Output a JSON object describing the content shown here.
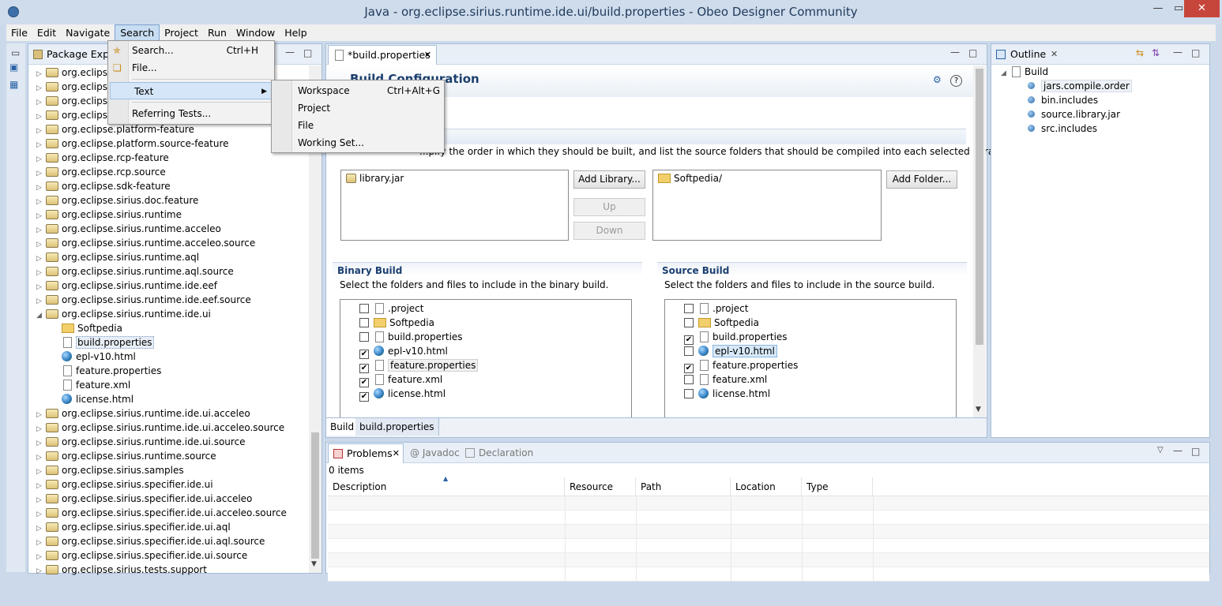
{
  "window": {
    "title": "Java - org.eclipse.sirius.runtime.ide.ui/build.properties - Obeo Designer Community"
  },
  "menubar": [
    "File",
    "Edit",
    "Navigate",
    "Search",
    "Project",
    "Run",
    "Window",
    "Help"
  ],
  "search_menu": {
    "items": [
      {
        "label": "Search...",
        "shortcut": "Ctrl+H"
      },
      {
        "label": "File...",
        "shortcut": ""
      },
      {
        "label": "Text",
        "shortcut": ""
      },
      {
        "label": "Referring Tests...",
        "shortcut": ""
      }
    ],
    "submenu": [
      {
        "label": "Workspace",
        "shortcut": "Ctrl+Alt+G"
      },
      {
        "label": "Project",
        "shortcut": ""
      },
      {
        "label": "File",
        "shortcut": ""
      },
      {
        "label": "Working Set...",
        "shortcut": ""
      }
    ]
  },
  "package_explorer": {
    "tab": "Package Explor",
    "items_partial": [
      "org.eclipse",
      "org.eclipse",
      "org.eclipse",
      "org.eclipse"
    ],
    "items": [
      "org.eclipse.platform-feature",
      "org.eclipse.platform.source-feature",
      "org.eclipse.rcp-feature",
      "org.eclipse.rcp.source",
      "org.eclipse.sdk-feature",
      "org.eclipse.sirius.doc.feature",
      "org.eclipse.sirius.runtime",
      "org.eclipse.sirius.runtime.acceleo",
      "org.eclipse.sirius.runtime.acceleo.source",
      "org.eclipse.sirius.runtime.aql",
      "org.eclipse.sirius.runtime.aql.source",
      "org.eclipse.sirius.runtime.ide.eef",
      "org.eclipse.sirius.runtime.ide.eef.source",
      "org.eclipse.sirius.runtime.ide.ui"
    ],
    "children": [
      "Softpedia",
      "build.properties",
      "epl-v10.html",
      "feature.properties",
      "feature.xml",
      "license.html"
    ],
    "items_after": [
      "org.eclipse.sirius.runtime.ide.ui.acceleo",
      "org.eclipse.sirius.runtime.ide.ui.acceleo.source",
      "org.eclipse.sirius.runtime.ide.ui.source",
      "org.eclipse.sirius.runtime.source",
      "org.eclipse.sirius.samples",
      "org.eclipse.sirius.specifier.ide.ui",
      "org.eclipse.sirius.specifier.ide.ui.acceleo",
      "org.eclipse.sirius.specifier.ide.ui.acceleo.source",
      "org.eclipse.sirius.specifier.ide.ui.aql",
      "org.eclipse.sirius.specifier.ide.ui.aql.source",
      "org.eclipse.sirius.specifier.ide.ui.source",
      "org.eclipse.sirius.tests.support"
    ]
  },
  "editor": {
    "tab": "*build.properties",
    "heading": "Build Configuration",
    "description": "...pify the order in which they should be built, and list the source folders that should be compiled into each selected library.",
    "library": "library.jar",
    "folder": "Softpedia/",
    "buttons": {
      "add_library": "Add Library...",
      "up": "Up",
      "down": "Down",
      "add_folder": "Add Folder..."
    },
    "binary": {
      "title": "Binary Build",
      "desc": "Select the folders and files to include in the binary build.",
      "items": [
        {
          "name": ".project",
          "checked": false
        },
        {
          "name": "Softpedia",
          "checked": false
        },
        {
          "name": "build.properties",
          "checked": false
        },
        {
          "name": "epl-v10.html",
          "checked": true
        },
        {
          "name": "feature.properties",
          "checked": true
        },
        {
          "name": "feature.xml",
          "checked": true
        },
        {
          "name": "license.html",
          "checked": true
        }
      ]
    },
    "source": {
      "title": "Source Build",
      "desc": "Select the folders and files to include in the source build.",
      "items": [
        {
          "name": ".project",
          "checked": false
        },
        {
          "name": "Softpedia",
          "checked": false
        },
        {
          "name": "build.properties",
          "checked": true
        },
        {
          "name": "epl-v10.html",
          "checked": false
        },
        {
          "name": "feature.properties",
          "checked": true
        },
        {
          "name": "feature.xml",
          "checked": false
        },
        {
          "name": "license.html",
          "checked": false
        }
      ]
    },
    "bottom_tabs": [
      "Build",
      "build.properties"
    ]
  },
  "outline": {
    "tab": "Outline",
    "root": "Build",
    "items": [
      "jars.compile.order",
      "bin.includes",
      "source.library.jar",
      "src.includes"
    ]
  },
  "problems": {
    "tabs": [
      "Problems",
      "Javadoc",
      "Declaration"
    ],
    "count": "0 items",
    "columns": [
      "Description",
      "Resource",
      "Path",
      "Location",
      "Type"
    ]
  },
  "icons": [
    "minimize-icon",
    "maximize-icon",
    "close-icon",
    "help-icon"
  ]
}
